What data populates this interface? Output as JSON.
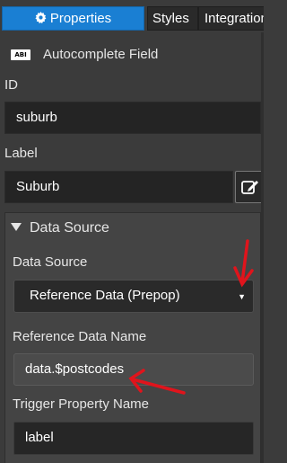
{
  "tabs": [
    {
      "label": "Properties",
      "icon": "gear-icon",
      "active": true
    },
    {
      "label": "Styles",
      "active": false
    },
    {
      "label": "Integration",
      "active": false
    }
  ],
  "component": {
    "badge": "ABI",
    "title": "Autocomplete Field"
  },
  "id_field": {
    "label": "ID",
    "value": "suburb"
  },
  "label_field": {
    "label": "Label",
    "value": "Suburb",
    "edit_icon": "edit-icon"
  },
  "data_source_section": {
    "heading": "Data Source",
    "data_source": {
      "label": "Data Source",
      "value": "Reference Data (Prepop)"
    },
    "reference_data_name": {
      "label": "Reference Data Name",
      "value": "data.$postcodes"
    },
    "trigger_property_name": {
      "label": "Trigger Property Name",
      "value": "label"
    }
  },
  "colors": {
    "accent": "#1a7fd3",
    "annotation": "#e0141c",
    "background": "#3b3b3b"
  }
}
